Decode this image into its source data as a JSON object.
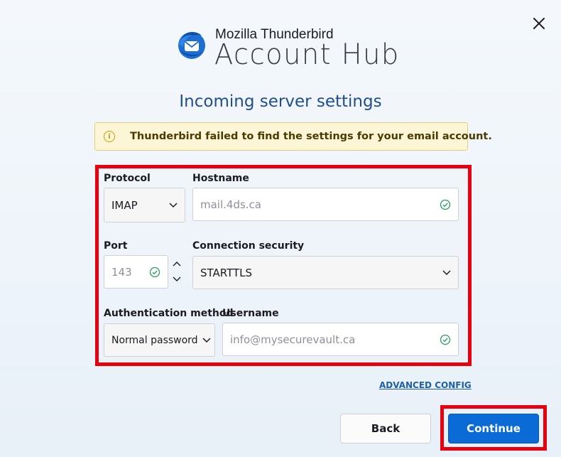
{
  "brand": {
    "small_name": "Mozilla Thunderbird",
    "big_name": "Account Hub",
    "logo_icon": "thunderbird-logo"
  },
  "close_icon": "close-icon",
  "page_title": "Incoming server settings",
  "warning": {
    "icon": "info-icon",
    "text": "Thunderbird failed to find the settings for your email account."
  },
  "form": {
    "protocol": {
      "label": "Protocol",
      "value": "IMAP",
      "options": [
        "IMAP"
      ]
    },
    "hostname": {
      "label": "Hostname",
      "value": "mail.4ds.ca",
      "valid": true
    },
    "port": {
      "label": "Port",
      "value": "143",
      "valid": true
    },
    "connection_security": {
      "label": "Connection security",
      "value": "STARTTLS"
    },
    "auth_method": {
      "label": "Authentication method",
      "value": "Normal password"
    },
    "username": {
      "label": "Username",
      "value": "info@mysecurevault.ca",
      "valid": true
    }
  },
  "advanced_config": "ADVANCED CONFIG",
  "buttons": {
    "back": "Back",
    "continue": "Continue"
  },
  "colors": {
    "accent": "#0a6bd6",
    "title": "#1e4e8c",
    "highlight": "#e8000f",
    "valid": "#2a9d5c",
    "warning_bg": "#fdf6d6"
  }
}
